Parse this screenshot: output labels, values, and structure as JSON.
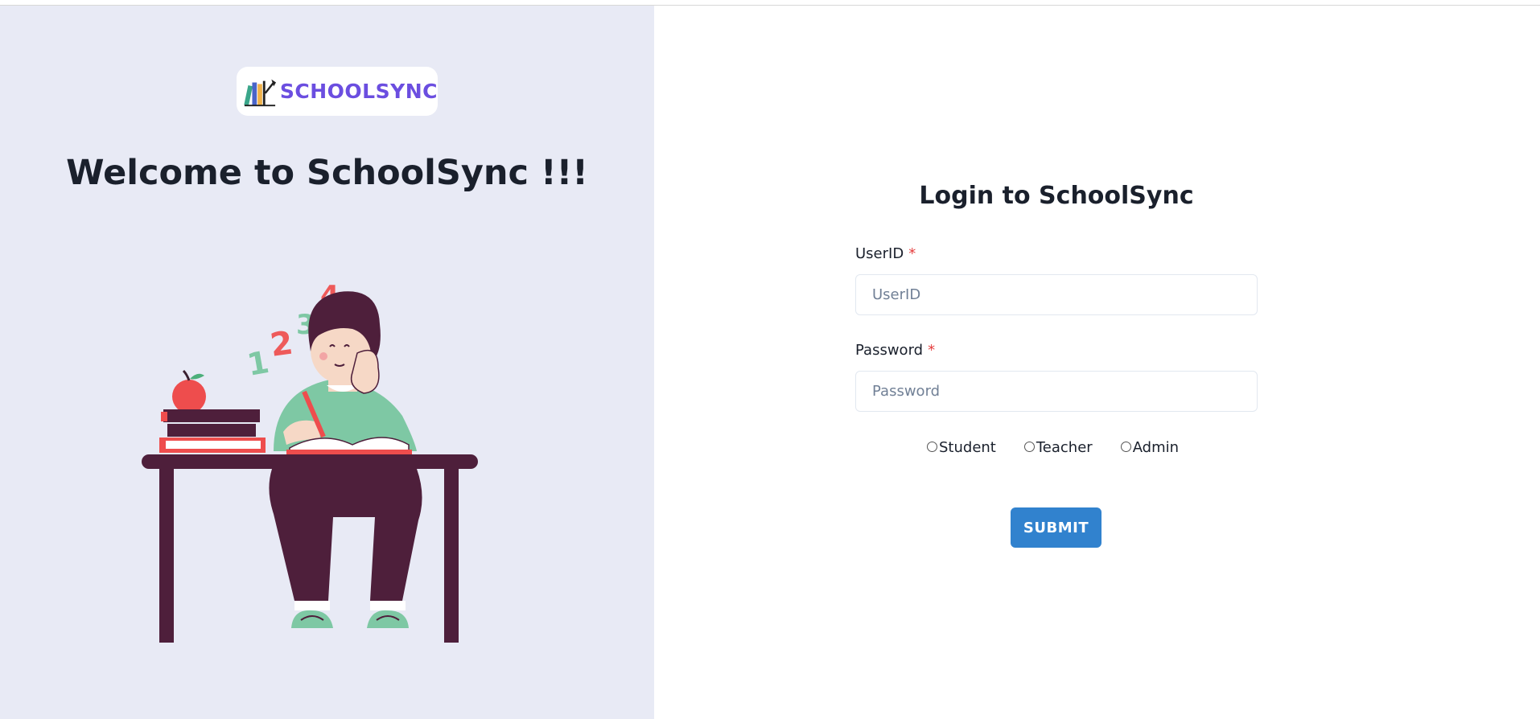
{
  "logo": {
    "text": "SCHOOLSYNC",
    "brand_color": "#6b4ee0",
    "icon": "books-icon"
  },
  "welcome": {
    "title": "Welcome to SchoolSync !!!"
  },
  "illustration": {
    "numbers": [
      "1",
      "2",
      "3",
      "4"
    ]
  },
  "login": {
    "title": "Login to SchoolSync",
    "userid": {
      "label": "UserID",
      "required_mark": "*",
      "placeholder": "UserID",
      "value": ""
    },
    "password": {
      "label": "Password",
      "required_mark": "*",
      "placeholder": "Password",
      "value": ""
    },
    "roles": [
      "Student",
      "Teacher",
      "Admin"
    ],
    "submit_label": "SUBMIT"
  },
  "colors": {
    "left_panel_bg": "#e8eaf5",
    "button": "#3182ce",
    "required": "#e53e3e"
  }
}
